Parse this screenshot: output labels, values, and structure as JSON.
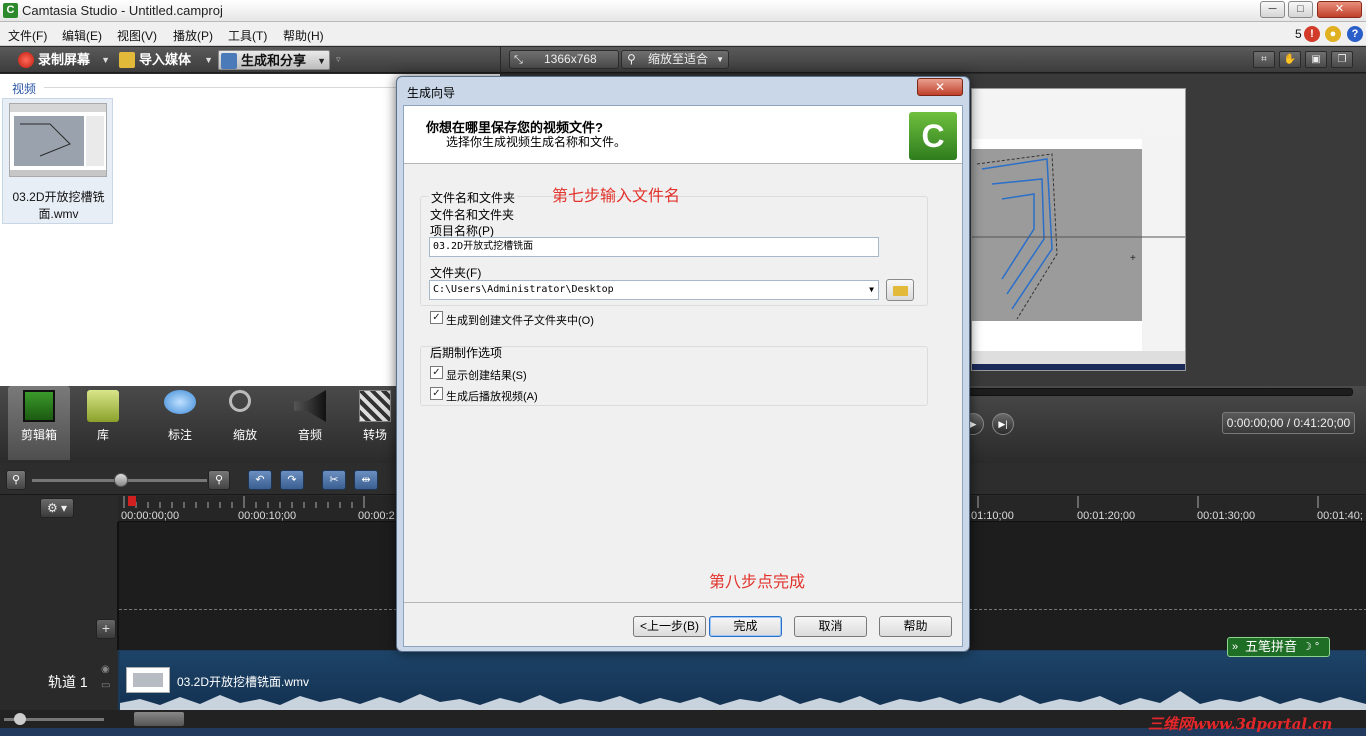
{
  "window": {
    "title": "Camtasia Studio - Untitled.camproj",
    "minimize": "─",
    "maximize": "□",
    "close": "✕"
  },
  "menu": {
    "items": [
      "文件(F)",
      "编辑(E)",
      "视图(V)",
      "播放(P)",
      "工具(T)",
      "帮助(H)"
    ],
    "notification_count": "5"
  },
  "left_toolbar": {
    "record": "录制屏幕",
    "import": "导入媒体",
    "share": "生成和分享"
  },
  "clip_bin": {
    "header": "视频",
    "clip_name": "03.2D开放挖槽铣面.wmv"
  },
  "preview": {
    "resolution": "1366x768",
    "zoom": "缩放至适合"
  },
  "tools": [
    {
      "label": "剪辑箱",
      "icon": "film-icon"
    },
    {
      "label": "库",
      "icon": "folder-icon"
    },
    {
      "label": "标注",
      "icon": "callout-icon"
    },
    {
      "label": "缩放",
      "icon": "magnifier-icon"
    },
    {
      "label": "音频",
      "icon": "speaker-icon"
    },
    {
      "label": "转场",
      "icon": "transition-icon"
    }
  ],
  "player": {
    "time": "0:00:00;00 / 0:41:20;00"
  },
  "timeline": {
    "ruler": [
      "00:00:00;00",
      "00:00:10;00",
      "00:00:2",
      "01:10;00",
      "00:01:20;00",
      "00:01:30;00",
      "00:01:40;"
    ],
    "track_label": "轨道 1",
    "clip_name": "03.2D开放挖槽铣面.wmv"
  },
  "ime": {
    "label": "五笔拼音"
  },
  "watermark": "三维网www.3dportal.cn",
  "dialog": {
    "title": "生成向导",
    "close": "✕",
    "question": "你想在哪里保存您的视频文件?",
    "subtitle": "选择你生成视频生成名称和文件。",
    "group1_title": "文件名和文件夹",
    "project_name_label": "项目名称(P)",
    "project_name_value": "03.2D开放式挖槽铣面",
    "folder_label": "文件夹(F)",
    "folder_value": "C:\\Users\\Administrator\\Desktop",
    "subfolder_checkbox": "生成到创建文件子文件夹中(O)",
    "group2_title": "后期制作选项",
    "show_results_checkbox": "显示创建结果(S)",
    "play_after_checkbox": "生成后播放视频(A)",
    "annotation_step7": "第七步输入文件名",
    "annotation_step8": "第八步点完成",
    "btn_back": "<上一步(B)",
    "btn_finish": "完成",
    "btn_cancel": "取消",
    "btn_help": "帮助"
  }
}
